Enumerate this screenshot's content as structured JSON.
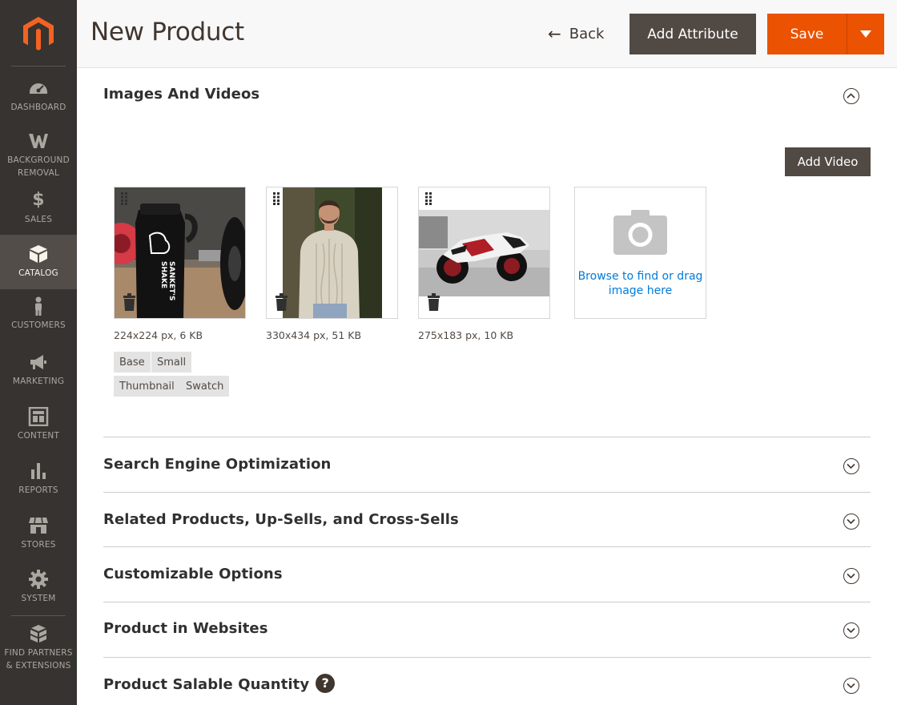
{
  "page": {
    "title": "New Product"
  },
  "header": {
    "back_label": "Back",
    "add_attribute_label": "Add Attribute",
    "save_label": "Save",
    "accent_color": "#eb5202"
  },
  "sidebar": {
    "logo": "magento-logo-icon",
    "items": [
      {
        "label": "DASHBOARD",
        "icon": "dashboard-icon"
      },
      {
        "label": "BACKGROUND REMOVAL",
        "icon": "background-removal-icon"
      },
      {
        "label": "SALES",
        "icon": "dollar-icon"
      },
      {
        "label": "CATALOG",
        "icon": "box-icon",
        "active": true
      },
      {
        "label": "CUSTOMERS",
        "icon": "person-icon"
      },
      {
        "label": "MARKETING",
        "icon": "megaphone-icon"
      },
      {
        "label": "CONTENT",
        "icon": "layout-icon"
      },
      {
        "label": "REPORTS",
        "icon": "bar-chart-icon"
      },
      {
        "label": "STORES",
        "icon": "store-icon"
      },
      {
        "label": "SYSTEM",
        "icon": "gear-icon"
      },
      {
        "label": "FIND PARTNERS & EXTENSIONS",
        "icon": "cubes-icon"
      }
    ]
  },
  "images_section": {
    "title": "Images And Videos",
    "add_video_label": "Add Video",
    "images": [
      {
        "meta": "224x224 px, 6 KB",
        "subject": "shaker-bottle",
        "roles": [
          "Base",
          "Small",
          "Thumbnail",
          "Swatch"
        ]
      },
      {
        "meta": "330x434 px, 51 KB",
        "subject": "sweater-man",
        "roles": []
      },
      {
        "meta": "275x183 px, 10 KB",
        "subject": "motorcycle",
        "roles": []
      }
    ],
    "upload_text": "Browse to find or drag image here",
    "shaker_text": "SANKET'S SHAKE"
  },
  "sections": [
    {
      "title": "Search Engine Optimization"
    },
    {
      "title": "Related Products, Up-Sells, and Cross-Sells"
    },
    {
      "title": "Customizable Options"
    },
    {
      "title": "Product in Websites"
    },
    {
      "title": "Product Salable Quantity",
      "help": "?"
    }
  ]
}
